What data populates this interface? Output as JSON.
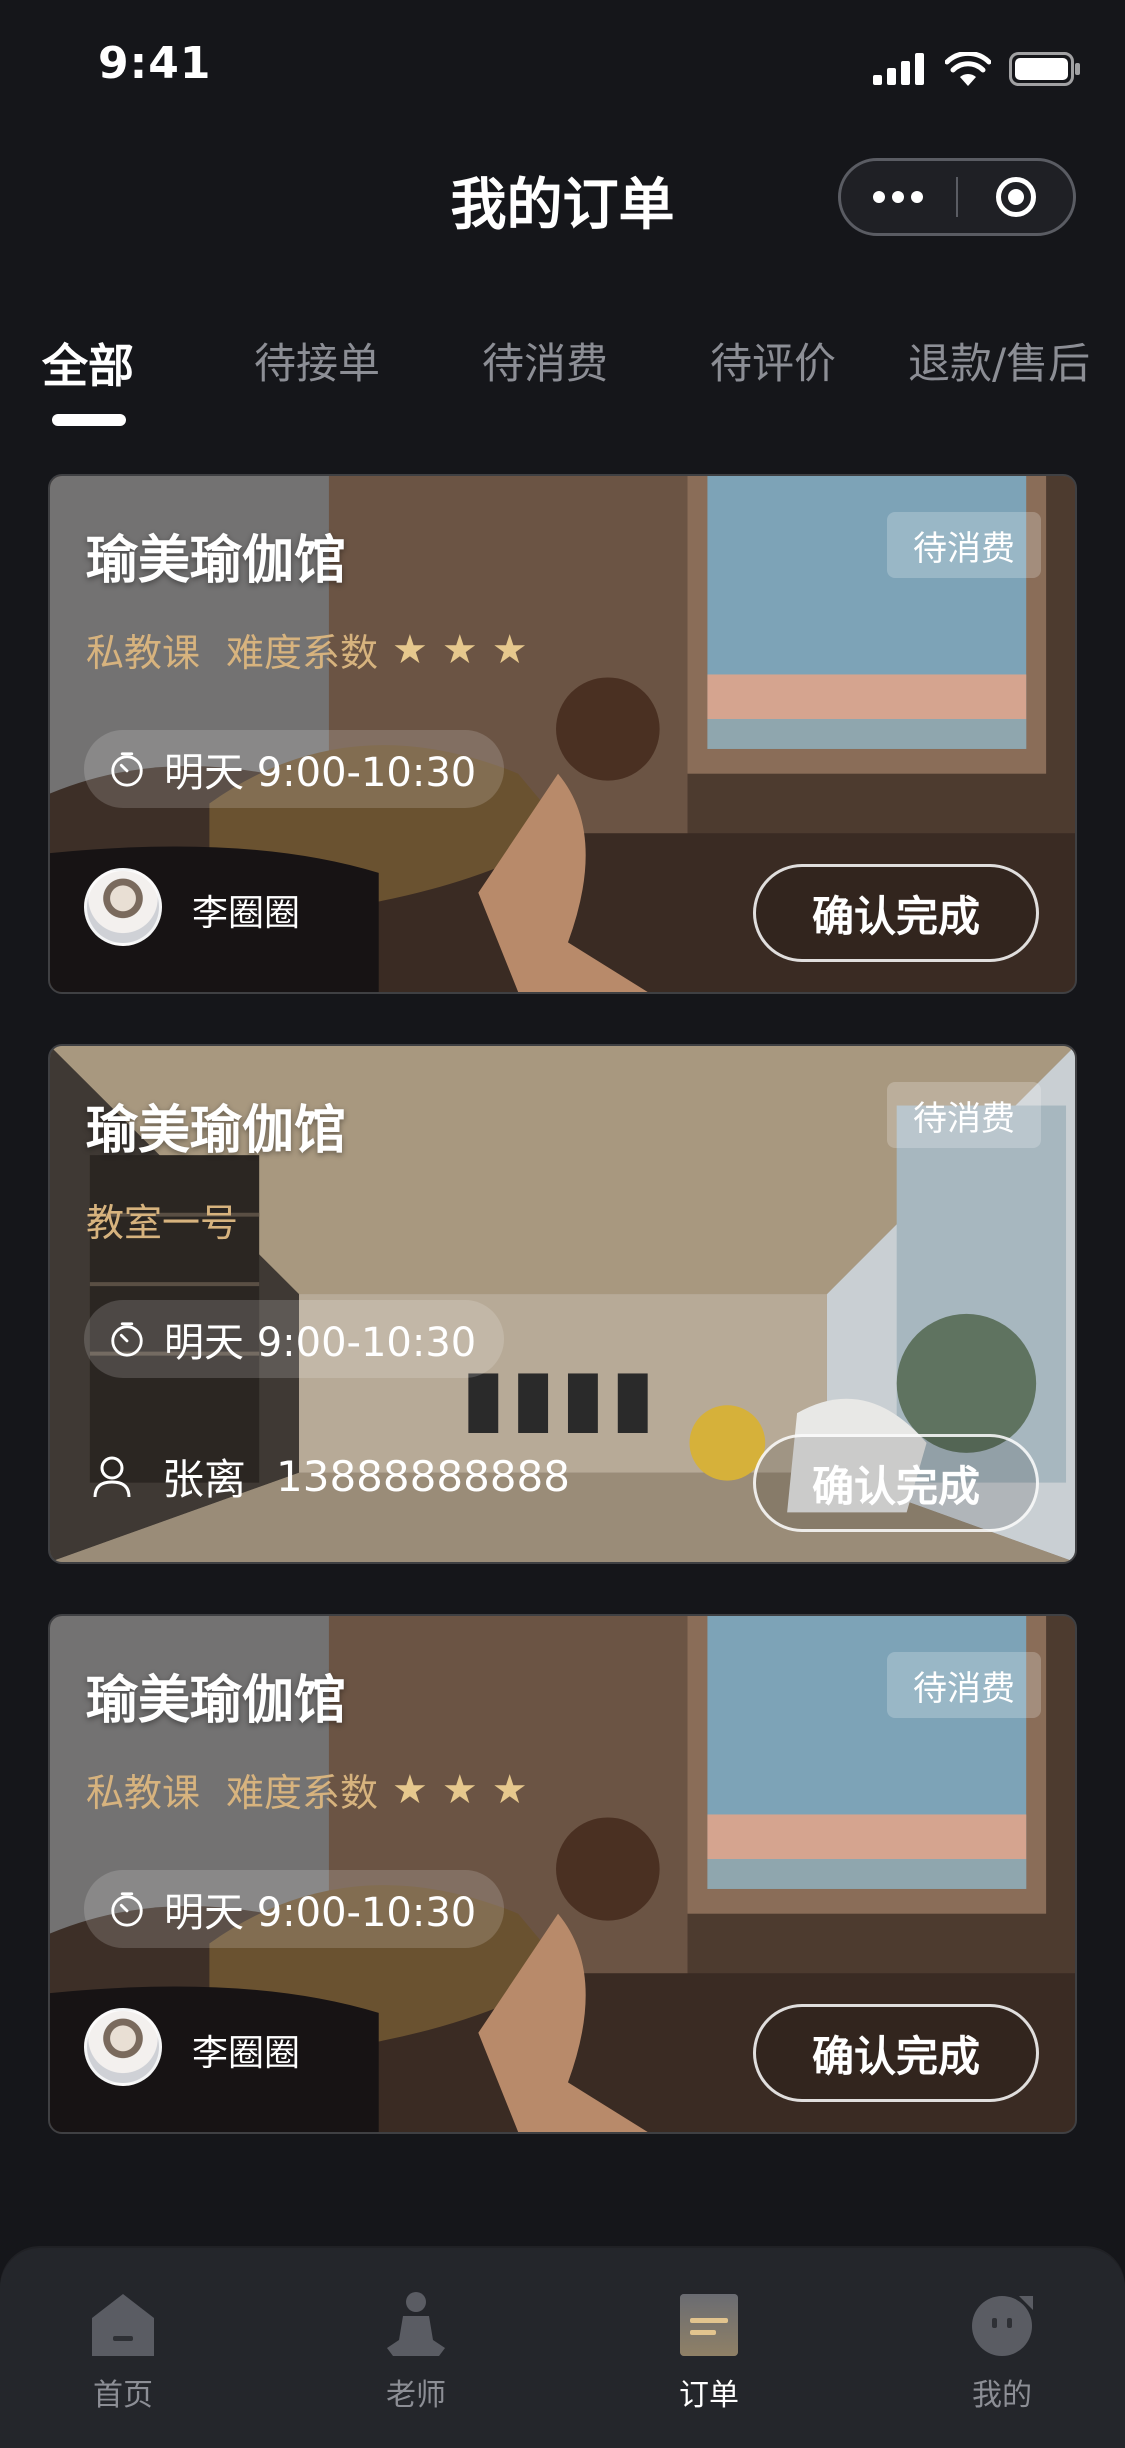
{
  "status_bar": {
    "time": "9:41"
  },
  "nav": {
    "title": "我的订单"
  },
  "tabs": [
    {
      "label": "全部",
      "active": true
    },
    {
      "label": "待接单"
    },
    {
      "label": "待消费"
    },
    {
      "label": "待评价"
    },
    {
      "label": "退款/售后"
    }
  ],
  "orders": [
    {
      "venue": "瑜美瑜伽馆",
      "course_type": "私教课",
      "difficulty_label": "难度系数",
      "difficulty_stars": 3,
      "status": "待消费",
      "time": "明天 9:00-10:30",
      "teacher": "李圈圈",
      "action": "确认完成"
    },
    {
      "venue": "瑜美瑜伽馆",
      "room": "教室一号",
      "status": "待消费",
      "time": "明天 9:00-10:30",
      "contact_name": "张离",
      "contact_phone": "13888888888",
      "action": "确认完成"
    },
    {
      "venue": "瑜美瑜伽馆",
      "course_type": "私教课",
      "difficulty_label": "难度系数",
      "difficulty_stars": 3,
      "status": "待消费",
      "time": "明天 9:00-10:30",
      "teacher": "李圈圈",
      "action": "确认完成"
    }
  ],
  "tabbar": [
    {
      "label": "首页",
      "icon": "home-icon"
    },
    {
      "label": "老师",
      "icon": "teacher-icon"
    },
    {
      "label": "订单",
      "icon": "order-icon",
      "active": true
    },
    {
      "label": "我的",
      "icon": "profile-icon"
    }
  ],
  "colors": {
    "accent_gold": "#d7b37e",
    "background": "#15161a",
    "tabbar": "#24262b"
  }
}
